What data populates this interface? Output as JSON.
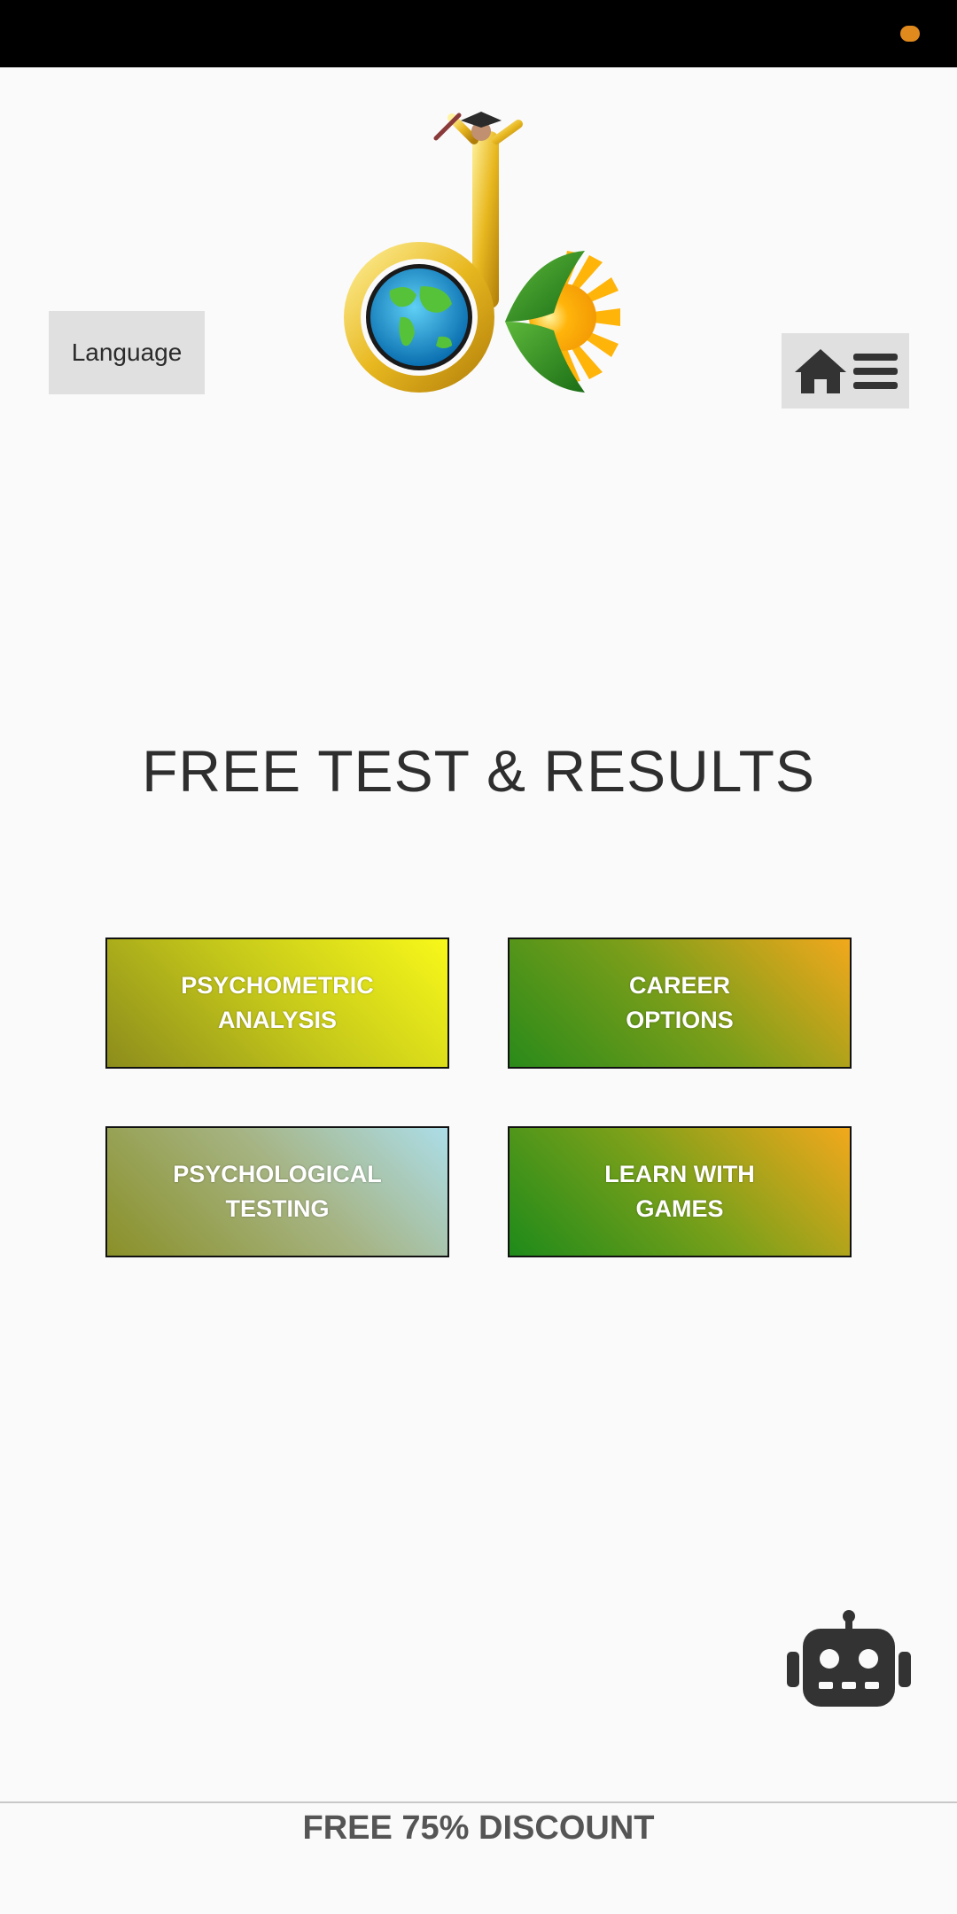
{
  "status_bar": {
    "indicator_icon": "notification-dot-icon",
    "indicator_color": "#e08a1e"
  },
  "header": {
    "language_label": "Language",
    "logo_icon": "dk-globe-logo-icon",
    "home_icon": "home-icon",
    "menu_icon": "hamburger-menu-icon"
  },
  "main": {
    "title": "FREE TEST & RESULTS",
    "tiles": [
      {
        "line1": "PSYCHOMETRIC",
        "line2": "ANALYSIS"
      },
      {
        "line1": "CAREER",
        "line2": "OPTIONS"
      },
      {
        "line1": "PSYCHOLOGICAL",
        "line2": "TESTING"
      },
      {
        "line1": "LEARN WITH",
        "line2": "GAMES"
      }
    ]
  },
  "chatbot": {
    "icon": "robot-icon"
  },
  "footer": {
    "discount_text": "FREE 75% DISCOUNT"
  },
  "colors": {
    "background": "#fafafa",
    "button_gray": "#e0e0e0",
    "title_text": "#2e2e2e",
    "icon_dark": "#333333"
  }
}
